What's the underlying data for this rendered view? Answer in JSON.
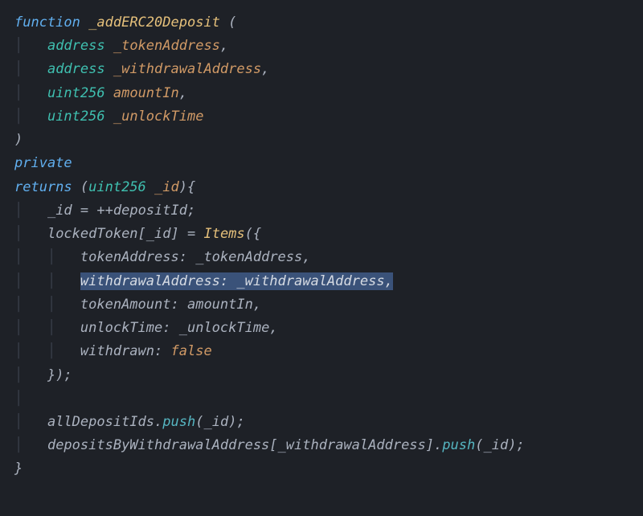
{
  "code": {
    "kw_function": "function",
    "fn_name": "_addERC20Deposit",
    "open_paren": " (",
    "params": {
      "p1_type": "address",
      "p1_name": "_tokenAddress",
      "p2_type": "address",
      "p2_name": "_withdrawalAddress",
      "p3_type": "uint256",
      "p3_name": "amountIn",
      "p4_type": "uint256",
      "p4_name": "_unlockTime"
    },
    "close_paren": ")",
    "kw_private": "private",
    "kw_returns": "returns",
    "ret_open": " (",
    "ret_type": "uint256",
    "ret_name": "_id",
    "ret_close_brace": "){",
    "body": {
      "l1_lhs": "_id",
      "l1_eq": " = ++",
      "l1_rhs": "depositId",
      "l1_semi": ";",
      "l2_map": "lockedToken",
      "l2_open": "[",
      "l2_key": "_id",
      "l2_close": "] = ",
      "l2_struct": "Items",
      "l2_paren": "({",
      "f1_key": "tokenAddress",
      "f1_colon": ": ",
      "f1_val": "_tokenAddress",
      "f1_comma": ",",
      "f2_line": "withdrawalAddress: _withdrawalAddress,",
      "f3_key": "tokenAmount",
      "f3_colon": ": ",
      "f3_val": "amountIn",
      "f3_comma": ",",
      "f4_key": "unlockTime",
      "f4_colon": ": ",
      "f4_val": "_unlockTime",
      "f4_comma": ",",
      "f5_key": "withdrawn",
      "f5_colon": ": ",
      "f5_val": "false",
      "struct_close": "});",
      "l3_arr": "allDepositIds",
      "l3_dot": ".",
      "l3_push": "push",
      "l3_open": "(",
      "l3_arg": "_id",
      "l3_close": ");",
      "l4_map": "depositsByWithdrawalAddress",
      "l4_open": "[",
      "l4_key": "_withdrawalAddress",
      "l4_close": "].",
      "l4_push": "push",
      "l4_popen": "(",
      "l4_arg": "_id",
      "l4_pclose": ");"
    },
    "fn_close": "}"
  }
}
